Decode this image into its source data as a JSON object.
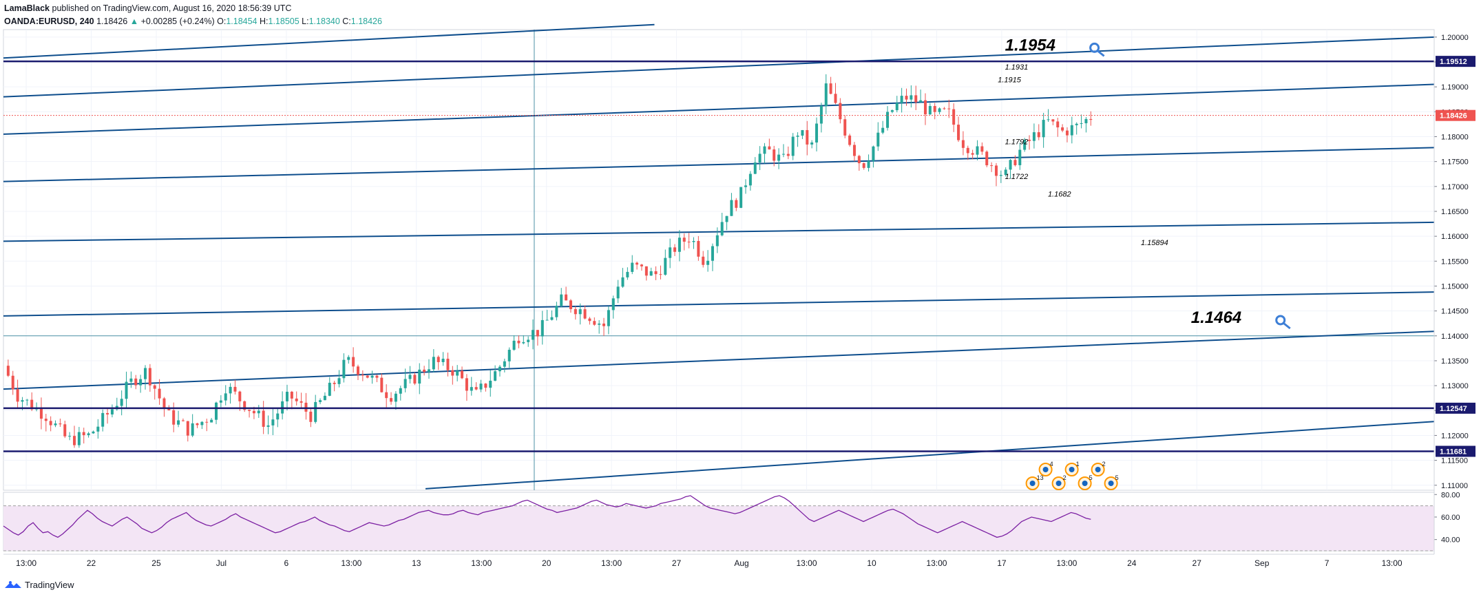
{
  "header": {
    "author": "LamaBlack",
    "published_text": "published on TradingView.com, August 16, 2020 18:56:39 UTC",
    "symbol": "OANDA:EURUSD, 240",
    "last": "1.18426",
    "change": "+0.00285 (+0.24%)",
    "open_label": "O:",
    "open": "1.18454",
    "high_label": "H:",
    "high": "1.18505",
    "low_label": "L:",
    "low": "1.18340",
    "close_label": "C:",
    "close": "1.18426"
  },
  "footer": {
    "brand": "TradingView"
  },
  "colors": {
    "up": "#26a69a",
    "down": "#ef5350",
    "channel": "#0d4d8c",
    "hline": "#1a1a6e",
    "thin_line": "#4a90a4",
    "price_line": "#ef5350",
    "rsi": "#7b1fa2",
    "rsi_band": "#f3e5f5",
    "annotation_key": "#3d7fd6"
  },
  "chart_data": [
    {
      "type": "candlestick",
      "symbol": "EURUSD",
      "interval": "240",
      "ylim": [
        1.109,
        1.2015
      ],
      "y_ticks": [
        "1.20000",
        "1.19500",
        "1.19000",
        "1.18500",
        "1.18000",
        "1.17500",
        "1.17000",
        "1.16500",
        "1.16000",
        "1.15500",
        "1.15000",
        "1.14500",
        "1.14000",
        "1.13500",
        "1.13000",
        "1.12500",
        "1.12000",
        "1.11500",
        "1.11000"
      ],
      "x_ticks": [
        "13:00",
        "22",
        "25",
        "Jul",
        "6",
        "13:00",
        "13",
        "13:00",
        "20",
        "13:00",
        "27",
        "Aug",
        "13:00",
        "10",
        "13:00",
        "17",
        "13:00",
        "24",
        "27",
        "Sep",
        "7",
        "13:00"
      ],
      "price_path": [
        [
          0,
          1.134
        ],
        [
          0.01,
          1.128
        ],
        [
          0.03,
          1.124
        ],
        [
          0.045,
          1.119
        ],
        [
          0.06,
          1.12
        ],
        [
          0.075,
          1.125
        ],
        [
          0.09,
          1.131
        ],
        [
          0.1,
          1.133
        ],
        [
          0.115,
          1.124
        ],
        [
          0.13,
          1.121
        ],
        [
          0.145,
          1.124
        ],
        [
          0.155,
          1.13
        ],
        [
          0.17,
          1.126
        ],
        [
          0.185,
          1.122
        ],
        [
          0.2,
          1.128
        ],
        [
          0.215,
          1.124
        ],
        [
          0.23,
          1.13
        ],
        [
          0.24,
          1.135
        ],
        [
          0.255,
          1.132
        ],
        [
          0.27,
          1.128
        ],
        [
          0.285,
          1.131
        ],
        [
          0.3,
          1.135
        ],
        [
          0.315,
          1.133
        ],
        [
          0.33,
          1.128
        ],
        [
          0.345,
          1.133
        ],
        [
          0.36,
          1.14
        ],
        [
          0.375,
          1.141
        ],
        [
          0.39,
          1.147
        ],
        [
          0.405,
          1.145
        ],
        [
          0.42,
          1.142
        ],
        [
          0.43,
          1.151
        ],
        [
          0.44,
          1.154
        ],
        [
          0.455,
          1.152
        ],
        [
          0.47,
          1.158
        ],
        [
          0.48,
          1.16
        ],
        [
          0.49,
          1.155
        ],
        [
          0.505,
          1.165
        ],
        [
          0.515,
          1.168
        ],
        [
          0.525,
          1.176
        ],
        [
          0.535,
          1.177
        ],
        [
          0.545,
          1.175
        ],
        [
          0.555,
          1.181
        ],
        [
          0.565,
          1.178
        ],
        [
          0.575,
          1.19
        ],
        [
          0.58,
          1.187
        ],
        [
          0.59,
          1.18
        ],
        [
          0.6,
          1.174
        ],
        [
          0.61,
          1.179
        ],
        [
          0.62,
          1.185
        ],
        [
          0.63,
          1.188
        ],
        [
          0.64,
          1.187
        ],
        [
          0.65,
          1.184
        ],
        [
          0.66,
          1.185
        ],
        [
          0.67,
          1.179
        ],
        [
          0.685,
          1.176
        ],
        [
          0.7,
          1.172
        ],
        [
          0.71,
          1.177
        ],
        [
          0.72,
          1.18
        ],
        [
          0.73,
          1.183
        ],
        [
          0.74,
          1.181
        ],
        [
          0.75,
          1.182
        ],
        [
          0.76,
          1.184
        ]
      ],
      "horizontal_levels": [
        "1.19512",
        "1.12547",
        "1.11681"
      ],
      "thin_level": 1.14,
      "current_price": "1.18426",
      "channel_lines": [
        {
          "from": [
            0,
            1.1958
          ],
          "to": [
            0.455,
            1.2025
          ]
        },
        {
          "from": [
            0,
            1.188
          ],
          "to": [
            1,
            1.2
          ],
          "mid_from": [
            0,
            1.188
          ],
          "mid_to": [
            1,
            1.2
          ]
        },
        {
          "from": [
            0,
            1.1805
          ],
          "to": [
            1,
            1.1905
          ]
        },
        {
          "from": [
            0,
            1.171
          ],
          "to": [
            1,
            1.1778
          ]
        },
        {
          "from": [
            0,
            1.159
          ],
          "to": [
            1,
            1.1628
          ]
        },
        {
          "from": [
            0,
            1.144
          ],
          "to": [
            1,
            1.1488
          ]
        },
        {
          "from": [
            0,
            1.1293
          ],
          "to": [
            1,
            1.1409
          ]
        },
        {
          "from": [
            0.295,
            1.1093
          ],
          "to": [
            1,
            1.1228
          ]
        }
      ],
      "annotations": [
        {
          "text": "1.1954",
          "size": "large",
          "x": 0.7,
          "y": 1.1973
        },
        {
          "text": "1.1931",
          "size": "small",
          "x": 0.7,
          "y": 1.1935
        },
        {
          "text": "1.1915",
          "size": "small",
          "x": 0.695,
          "y": 1.1909
        },
        {
          "text": "1.1792",
          "size": "small",
          "x": 0.7,
          "y": 1.1785
        },
        {
          "text": "1.1722",
          "size": "small",
          "x": 0.7,
          "y": 1.1715
        },
        {
          "text": "1.1682",
          "size": "small",
          "x": 0.73,
          "y": 1.168
        },
        {
          "text": "1.15894",
          "size": "small",
          "x": 0.795,
          "y": 1.1582
        },
        {
          "text": "1.1464",
          "size": "large",
          "x": 0.83,
          "y": 1.1426
        }
      ],
      "event_badges": [
        "13",
        "4",
        "2",
        "1",
        "5",
        "2",
        "5"
      ]
    },
    {
      "type": "line",
      "indicator": "RSI",
      "ylim": [
        30,
        82
      ],
      "y_ticks": [
        "80.00",
        "60.00",
        "40.00"
      ],
      "band": [
        30,
        70
      ],
      "values": [
        52,
        49,
        46,
        44,
        47,
        52,
        55,
        50,
        46,
        47,
        44,
        42,
        45,
        49,
        53,
        58,
        62,
        66,
        63,
        59,
        56,
        54,
        52,
        55,
        58,
        60,
        57,
        54,
        50,
        48,
        46,
        48,
        51,
        55,
        58,
        60,
        62,
        64,
        60,
        57,
        55,
        53,
        52,
        54,
        56,
        58,
        61,
        63,
        60,
        58,
        56,
        54,
        52,
        50,
        48,
        46,
        47,
        49,
        51,
        53,
        55,
        56,
        58,
        60,
        57,
        55,
        53,
        52,
        50,
        48,
        47,
        49,
        51,
        53,
        55,
        54,
        53,
        52,
        53,
        55,
        57,
        58,
        60,
        62,
        64,
        65,
        66,
        64,
        63,
        62,
        62,
        63,
        65,
        66,
        64,
        63,
        62,
        64,
        65,
        66,
        67,
        68,
        69,
        70,
        72,
        74,
        75,
        73,
        71,
        69,
        67,
        66,
        64,
        65,
        66,
        67,
        68,
        70,
        72,
        74,
        75,
        73,
        71,
        70,
        69,
        70,
        72,
        71,
        70,
        69,
        68,
        69,
        70,
        72,
        73,
        74,
        75,
        76,
        78,
        79,
        76,
        73,
        70,
        68,
        67,
        66,
        65,
        64,
        63,
        64,
        66,
        68,
        70,
        72,
        74,
        76,
        78,
        79,
        77,
        74,
        70,
        66,
        62,
        58,
        56,
        58,
        60,
        62,
        64,
        66,
        64,
        62,
        60,
        58,
        56,
        58,
        60,
        62,
        64,
        66,
        67,
        65,
        63,
        60,
        57,
        54,
        52,
        50,
        48,
        46,
        48,
        50,
        52,
        54,
        56,
        54,
        52,
        50,
        48,
        46,
        44,
        42,
        43,
        45,
        48,
        52,
        56,
        58,
        60,
        59,
        58,
        57,
        56,
        58,
        60,
        62,
        64,
        63,
        61,
        59,
        58
      ]
    }
  ]
}
